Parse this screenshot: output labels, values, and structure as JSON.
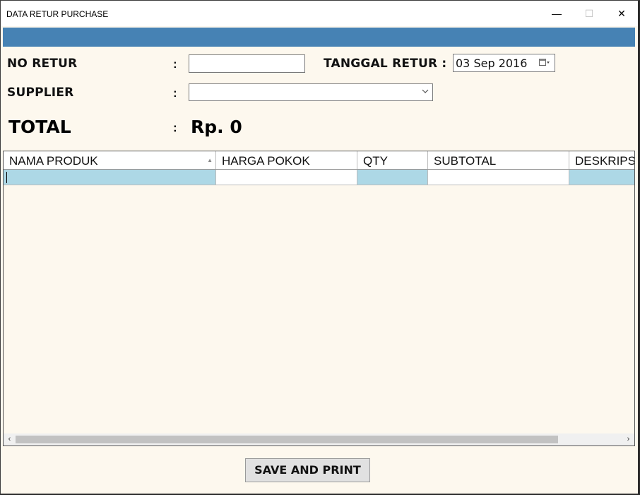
{
  "window": {
    "title": "DATA RETUR PURCHASE",
    "controls": {
      "minimize": "—",
      "maximize": "☐",
      "close": "✕"
    }
  },
  "form": {
    "no_retur_label": "NO RETUR",
    "no_retur_value": "",
    "tanggal_label": "TANGGAL RETUR :",
    "tanggal_value": "03 Sep 2016",
    "supplier_label": "SUPPLIER",
    "supplier_value": "",
    "colon": ":"
  },
  "total": {
    "label": "TOTAL",
    "value": "Rp. 0"
  },
  "grid": {
    "columns": [
      "NAMA PRODUK",
      "HARGA POKOK",
      "QTY",
      "SUBTOTAL",
      "DESKRIPSI"
    ],
    "rows": [
      [
        "",
        "",
        "",
        "",
        ""
      ]
    ]
  },
  "actions": {
    "save_print": "SAVE AND PRINT"
  },
  "icons": {
    "calendar": "calendar-icon",
    "dropdown": "chevron-down-icon",
    "sort": "sort-ascending-icon"
  },
  "colors": {
    "header_bar": "#4682b4",
    "selected_cell": "#add8e6",
    "background": "#fdf8ee"
  }
}
